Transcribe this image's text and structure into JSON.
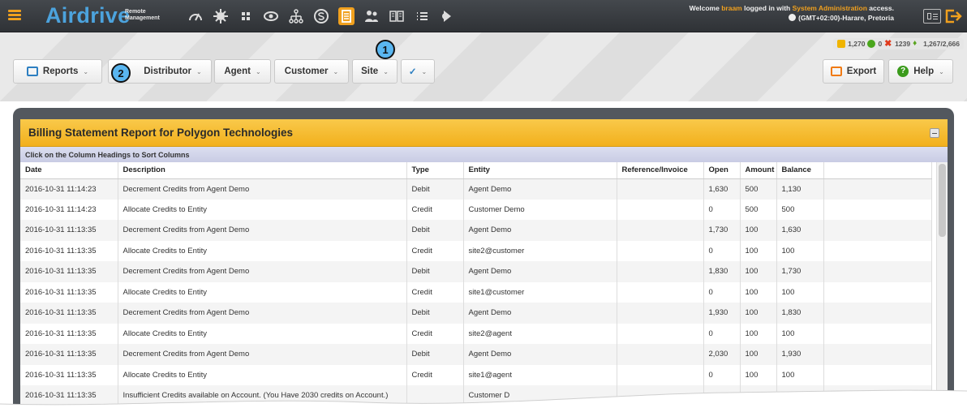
{
  "app": {
    "logo": "Airdrive",
    "logo_sub_line1": "Remote",
    "logo_sub_line2": "Management"
  },
  "nav_icons": [
    "dashboard-icon",
    "settings-gear-icon",
    "grid-icon",
    "eye-icon",
    "hierarchy-icon",
    "currency-icon",
    "report-icon",
    "users-icon",
    "book-icon",
    "list-icon",
    "mic-icon"
  ],
  "welcome": {
    "prefix": "Welcome",
    "user": "braam",
    "middle": "logged in with",
    "access": "System Administration",
    "suffix": "access.",
    "timezone": "(GMT+02:00)-Harare, Pretoria"
  },
  "stats": {
    "coins": "1,270",
    "ok": "0",
    "bad": "1239",
    "fav": "1,267/2,666"
  },
  "toolbar": {
    "reports": "Reports",
    "distributor": "Distributor",
    "agent": "Agent",
    "customer": "Customer",
    "site": "Site",
    "check": "✓",
    "export": "Export",
    "help": "Help",
    "caret": "⌄"
  },
  "badges": {
    "one": "1",
    "two": "2"
  },
  "report": {
    "title": "Billing Statement Report for Polygon Technologies",
    "sort_hint": "Click on the Column Headings to Sort Columns",
    "columns": [
      "Date",
      "Description",
      "Type",
      "Entity",
      "Reference/Invoice",
      "Open",
      "Amount",
      "Balance",
      ""
    ],
    "rows": [
      [
        "2016-10-31 11:14:23",
        "Decrement Credits from Agent Demo",
        "Debit",
        "Agent Demo",
        "",
        "1,630",
        "500",
        "1,130",
        ""
      ],
      [
        "2016-10-31 11:14:23",
        "Allocate Credits to Entity",
        "Credit",
        "Customer Demo",
        "",
        "0",
        "500",
        "500",
        ""
      ],
      [
        "2016-10-31 11:13:35",
        "Decrement Credits from Agent Demo",
        "Debit",
        "Agent Demo",
        "",
        "1,730",
        "100",
        "1,630",
        ""
      ],
      [
        "2016-10-31 11:13:35",
        "Allocate Credits to Entity",
        "Credit",
        "site2@customer",
        "",
        "0",
        "100",
        "100",
        ""
      ],
      [
        "2016-10-31 11:13:35",
        "Decrement Credits from Agent Demo",
        "Debit",
        "Agent Demo",
        "",
        "1,830",
        "100",
        "1,730",
        ""
      ],
      [
        "2016-10-31 11:13:35",
        "Allocate Credits to Entity",
        "Credit",
        "site1@customer",
        "",
        "0",
        "100",
        "100",
        ""
      ],
      [
        "2016-10-31 11:13:35",
        "Decrement Credits from Agent Demo",
        "Debit",
        "Agent Demo",
        "",
        "1,930",
        "100",
        "1,830",
        ""
      ],
      [
        "2016-10-31 11:13:35",
        "Allocate Credits to Entity",
        "Credit",
        "site2@agent",
        "",
        "0",
        "100",
        "100",
        ""
      ],
      [
        "2016-10-31 11:13:35",
        "Decrement Credits from Agent Demo",
        "Debit",
        "Agent Demo",
        "",
        "2,030",
        "100",
        "1,930",
        ""
      ],
      [
        "2016-10-31 11:13:35",
        "Allocate Credits to Entity",
        "Credit",
        "site1@agent",
        "",
        "0",
        "100",
        "100",
        ""
      ],
      [
        "2016-10-31 11:13:35",
        "Insufficient Credits available on Account. (You Have 2030 credits on Account.)",
        "",
        "Customer D",
        "",
        "",
        "",
        "",
        ""
      ]
    ]
  }
}
